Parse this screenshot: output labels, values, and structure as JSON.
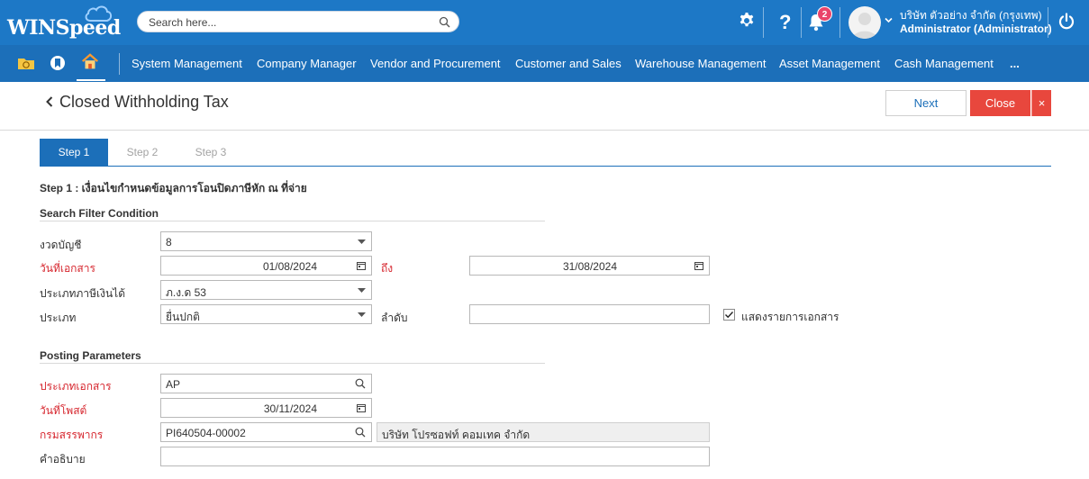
{
  "app": {
    "logo_text": "WINSpeed"
  },
  "search": {
    "placeholder": "Search here..."
  },
  "header": {
    "notification_count": "2",
    "company_name": "บริษัท ตัวอย่าง จำกัด (กรุงเทพ)",
    "user_name": "Administrator (Administrator)"
  },
  "menu": {
    "items": [
      "System Management",
      "Company Manager",
      "Vendor and Procurement",
      "Customer and Sales",
      "Warehouse Management",
      "Asset Management",
      "Cash Management",
      "..."
    ]
  },
  "page": {
    "title": "Closed Withholding Tax",
    "next_label": "Next",
    "close_label": "Close",
    "close_x": "×"
  },
  "steps": {
    "tabs": [
      "Step 1",
      "Step 2",
      "Step 3"
    ],
    "active": "Step 1",
    "heading": "Step 1 : เงื่อนไขกำหนดข้อมูลการโอนปิดภาษีหัก ณ ที่จ่าย"
  },
  "filter": {
    "section_title": "Search Filter Condition",
    "period_label": "งวดบัญชี",
    "period_value": "8",
    "doc_date_label": "วันที่เอกสาร",
    "doc_date_from": "01/08/2024",
    "to_label": "ถึง",
    "doc_date_to": "31/08/2024",
    "income_type_label": "ประเภทภาษีเงินได้",
    "income_type_value": "ภ.ง.ด 53",
    "type_label": "ประเภท",
    "type_value": "ยื่นปกติ",
    "sequence_label": "ลำดับ",
    "sequence_value": "",
    "show_docs_label": "แสดงรายการเอกสาร",
    "show_docs_checked": true
  },
  "posting": {
    "section_title": "Posting Parameters",
    "doc_type_label": "ประเภทเอกสาร",
    "doc_type_value": "AP",
    "post_date_label": "วันที่โพสต์",
    "post_date_value": "30/11/2024",
    "revenue_dept_label": "กรมสรรพากร",
    "revenue_dept_code": "PI640504-00002",
    "revenue_dept_name": "บริษัท โปรซอฟท์ คอมเทค จำกัด",
    "description_label": "คำอธิบาย",
    "description_value": ""
  },
  "colors": {
    "header_blue": "#1d78c6",
    "menu_blue": "#1c6fb9",
    "close_red": "#e8473d",
    "required_red": "#d6262e",
    "badge_pink": "#e9446a"
  }
}
